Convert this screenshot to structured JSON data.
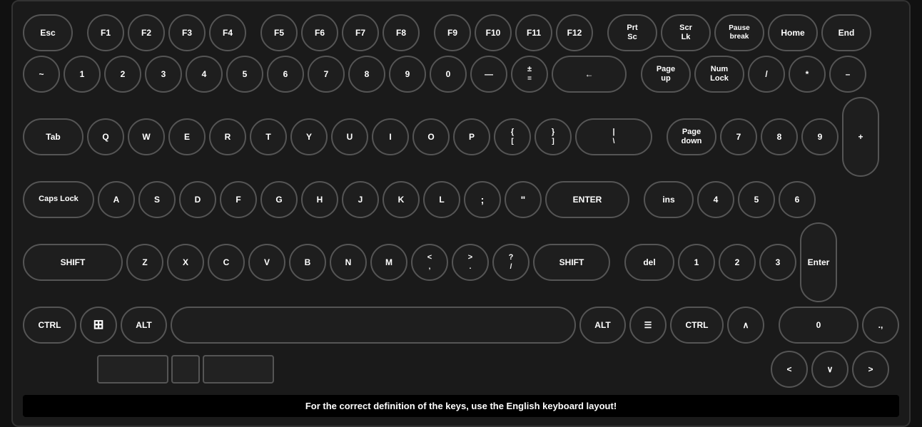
{
  "keyboard": {
    "footer": "For the correct definition of the keys, use the English keyboard layout!",
    "rows": {
      "row1": [
        "Esc",
        "",
        "F1",
        "F2",
        "F3",
        "F4",
        "",
        "F5",
        "F6",
        "F7",
        "F8",
        "",
        "F9",
        "F10",
        "F11",
        "F12",
        "",
        "Prt\nSc",
        "Scr\nLk",
        "Pause\nbreak",
        "Home",
        "End"
      ],
      "row2": [
        "~",
        "1",
        "2",
        "3",
        "4",
        "5",
        "6",
        "7",
        "8",
        "9",
        "0",
        "—",
        "±\n=",
        "←",
        "",
        "Page\nup",
        "Num\nLock",
        "/",
        "*",
        "–"
      ],
      "row3": [
        "Tab",
        "Q",
        "W",
        "E",
        "R",
        "T",
        "Y",
        "U",
        "I",
        "O",
        "P",
        "{\n[",
        "}\n]",
        "|\n\\",
        "",
        "Page\ndown",
        "7",
        "8",
        "9"
      ],
      "row4": [
        "Caps Lock",
        "A",
        "S",
        "D",
        "F",
        "G",
        "H",
        "J",
        "K",
        "L",
        ":",
        "\"",
        "ENTER",
        "",
        "ins",
        "4",
        "5",
        "6"
      ],
      "row5": [
        "SHIFT",
        "Z",
        "X",
        "C",
        "V",
        "B",
        "N",
        "M",
        "<\n,",
        ">\n.",
        "?\n/",
        "SHIFT",
        "",
        "del",
        "1",
        "2",
        "3"
      ],
      "row6": [
        "CTRL",
        "",
        "ALT",
        "",
        "ALT",
        "≡",
        "CTRL",
        "∧",
        "0",
        ".,"
      ],
      "row7_arrows": [
        "<",
        "∨",
        ">"
      ]
    }
  }
}
